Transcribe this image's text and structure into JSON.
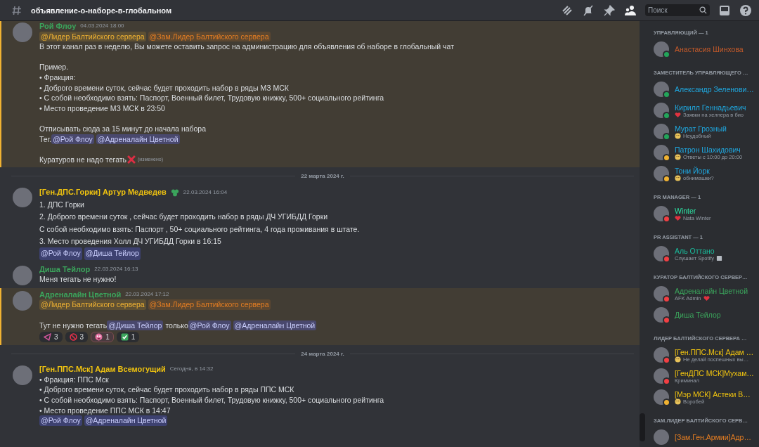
{
  "channel": {
    "name": "объявление-о-наборе-в-глобальном"
  },
  "search": {
    "placeholder": "Поиск"
  },
  "messages": [
    {
      "kind": "message",
      "author": "Рой Флоу",
      "color": "#3ba55c",
      "timestamp": "04.03.2024 18:00",
      "highlighted": true,
      "badge": false,
      "loose": false,
      "lines": [
        {
          "parts": [
            {
              "kind": "leader_mention",
              "text": "@Лидер Балтийского  сервера"
            },
            {
              "kind": "deputy_mention",
              "text": "@Зам.Лидер Балтийского сервера"
            }
          ]
        },
        {
          "parts": [
            {
              "kind": "text",
              "text": "В этот канал раз в неделю, Вы можете оставить запрос на администрацию для объявления об наборе в глобальный чат"
            }
          ]
        },
        {
          "gap": true,
          "parts": [
            {
              "kind": "text",
              "text": "Пример."
            }
          ]
        },
        {
          "parts": [
            {
              "kind": "text",
              "text": "• Фракция:"
            }
          ]
        },
        {
          "parts": [
            {
              "kind": "text",
              "text": "• Доброго времени суток, сейчас будет проходить набор в ряды МЗ МСК"
            }
          ]
        },
        {
          "parts": [
            {
              "kind": "text",
              "text": "• С собой необходимо взять: Паспорт, Военный билет, Трудовую книжку, 500+ социального рейтинга"
            }
          ]
        },
        {
          "parts": [
            {
              "kind": "text",
              "text": "• Место проведение МЗ МСК в 23:50"
            }
          ]
        },
        {
          "gap": true,
          "parts": [
            {
              "kind": "text",
              "text": "Отписывать сюда за 15 минут до начала набора"
            }
          ]
        },
        {
          "parts": [
            {
              "kind": "text",
              "text": "Тег. "
            },
            {
              "kind": "user_mention",
              "text": "@Рой Флоу"
            },
            {
              "kind": "user_mention",
              "text": "@Адреналайн Цветной"
            }
          ]
        },
        {
          "gap": true,
          "parts": [
            {
              "kind": "text",
              "text": "Куратуров не надо тегать"
            },
            {
              "kind": "cross"
            },
            {
              "kind": "edited",
              "text": "(изменено)"
            }
          ]
        }
      ]
    },
    {
      "kind": "divider",
      "text": "22 марта 2024 г."
    },
    {
      "kind": "message",
      "author": "[Ген.ДПС.Горки] Артур Медведев",
      "color": "#f1c40f",
      "timestamp": "22.03.2024 16:04",
      "highlighted": false,
      "badge": true,
      "loose": true,
      "lines": [
        {
          "parts": [
            {
              "kind": "text",
              "text": "1. ДПС Горки"
            }
          ]
        },
        {
          "parts": [
            {
              "kind": "text",
              "text": "2. Доброго времени суток , сейчас будет проходить набор в ряды ДЧ УГИБДД Горки"
            }
          ]
        },
        {
          "parts": [
            {
              "kind": "text",
              "text": "С собой необходимо взять: Паспорт , 50+ социального рейтинга, 4 года проживания в штате."
            }
          ]
        },
        {
          "parts": [
            {
              "kind": "text",
              "text": "3. Место проведения Холл ДЧ УГИБДД Горки в 16:15"
            }
          ]
        },
        {
          "parts": [
            {
              "kind": "user_mention",
              "text": "@Рой Флоу"
            },
            {
              "kind": "user_mention",
              "text": "@Диша Тейлор"
            }
          ]
        }
      ]
    },
    {
      "kind": "message",
      "author": "Диша Тейлор",
      "color": "#3ba55c",
      "timestamp": "22.03.2024 16:13",
      "highlighted": false,
      "badge": false,
      "loose": false,
      "lines": [
        {
          "parts": [
            {
              "kind": "text",
              "text": "Меня тегать не нужно!"
            }
          ]
        }
      ]
    },
    {
      "kind": "message",
      "author": "Адреналайн Цветной",
      "color": "#3ba55c",
      "timestamp": "22.03.2024 17:12",
      "highlighted": true,
      "badge": false,
      "loose": false,
      "lines": [
        {
          "parts": [
            {
              "kind": "leader_mention",
              "text": "@Лидер Балтийского  сервера"
            },
            {
              "kind": "deputy_mention",
              "text": "@Зам.Лидер Балтийского сервера"
            }
          ]
        },
        {
          "gap": true,
          "parts": [
            {
              "kind": "text",
              "text": " Тут не нужно тегать "
            },
            {
              "kind": "user_mention",
              "text": "@Диша Тейлор"
            },
            {
              "kind": "text",
              "text": " только "
            },
            {
              "kind": "user_mention",
              "text": "@Рой Флоу"
            },
            {
              "kind": "user_mention",
              "text": "@Адреналайн Цветной"
            }
          ]
        }
      ],
      "reactions": [
        {
          "kind": "triangle",
          "count": "3",
          "selected": false
        },
        {
          "kind": "forbidden",
          "count": "3",
          "selected": false
        },
        {
          "kind": "face",
          "count": "1",
          "selected": true
        },
        {
          "kind": "check",
          "count": "1",
          "selected": false
        }
      ]
    },
    {
      "kind": "divider",
      "text": "24 марта 2024 г."
    },
    {
      "kind": "message",
      "author": "[Ген.ППС.Мск] Адам Всемогущий",
      "color": "#f1c40f",
      "timestamp": "Сегодня, в 14:32",
      "highlighted": false,
      "badge": false,
      "loose": false,
      "lines": [
        {
          "parts": [
            {
              "kind": "text",
              "text": "• Фракция: ППС Мск"
            }
          ]
        },
        {
          "parts": [
            {
              "kind": "text",
              "text": "• Доброго времени суток, сейчас будет проходить набор в ряды ППС МСК"
            }
          ]
        },
        {
          "parts": [
            {
              "kind": "text",
              "text": "• С собой необходимо взять: Паспорт, Военный билет, Трудовую книжку, 500+ социального рейтинга"
            }
          ]
        },
        {
          "parts": [
            {
              "kind": "text",
              "text": "• Место проведение ППС МСК в 14:47"
            }
          ]
        },
        {
          "parts": [
            {
              "kind": "user_mention",
              "text": "@Рой Флоу"
            },
            {
              "kind": "user_mention",
              "text": "@Адреналайн Цветной"
            }
          ]
        }
      ]
    }
  ],
  "member_sections": [
    {
      "header": "УПРАВЛЯЮЩИЙ — 1",
      "members": [
        {
          "name": "Анастасия Шинхова",
          "color": "#c55a2a",
          "status": {
            "color": "#23a55a"
          }
        }
      ]
    },
    {
      "header": "ЗАМЕСТИТЕЛЬ УПРАВЛЯЮЩЕГО …",
      "members": [
        {
          "name": "Александр Зеленови…",
          "color": "#1fa8e0",
          "status": {
            "color": "#23a55a"
          }
        },
        {
          "name": "Кирилл Геннадьевич",
          "color": "#1fa8e0",
          "status": {
            "color": "#23a55a"
          },
          "activity": {
            "kind": "heart",
            "text": "Заявки на хелпера в био",
            "icon_after": false
          }
        },
        {
          "name": "Мурат Грозный",
          "color": "#1fa8e0",
          "status": {
            "color": "#23a55a"
          },
          "activity": {
            "kind": "emoji",
            "text": "Неудобный",
            "icon_after": false
          }
        },
        {
          "name": "Патрон Шахидович",
          "color": "#1fa8e0",
          "status": {
            "color": "#f0b232"
          },
          "activity": {
            "kind": "emoji",
            "text": "Ответы с 10:00 до 20:00",
            "icon_after": false
          }
        },
        {
          "name": "Тони Йорк",
          "color": "#1fa8e0",
          "status": {
            "color": "#f0b232"
          },
          "activity": {
            "kind": "emoji",
            "text": "обнимашки?",
            "icon_after": false
          }
        }
      ]
    },
    {
      "header": "PR MANAGER — 1",
      "members": [
        {
          "name": "Winter",
          "color": "#2ee6a6",
          "status": {
            "color": "#f23f43"
          },
          "activity": {
            "kind": "heart",
            "text": "Nata Winter",
            "icon_after": false
          }
        }
      ]
    },
    {
      "header": "PR ASSISTANT — 1",
      "members": [
        {
          "name": "Аль Оттано",
          "color": "#1abc9c",
          "status": {
            "color": "#f23f43"
          },
          "activity": {
            "kind": "square",
            "text": "Слушает Spotify",
            "icon_after": true
          }
        }
      ]
    },
    {
      "header": "КУРАТОР БАЛТИЙСКОГО СЕРВЕР…",
      "members": [
        {
          "name": "Адреналайн Цветной",
          "color": "#3ba55c",
          "status": {
            "color": "#f23f43"
          },
          "activity": {
            "kind": "heart",
            "text": "AFK Admin",
            "icon_after": true
          }
        },
        {
          "name": "Диша Тейлор",
          "color": "#3ba55c",
          "status": {
            "color": "#f23f43"
          }
        }
      ]
    },
    {
      "header": "ЛИДЕР БАЛТИЙСКОГО СЕРВЕРА …",
      "members": [
        {
          "name": "[Ген.ППС.Мск] Адам …",
          "color": "#f1c40f",
          "status": {
            "color": "#f23f43"
          },
          "activity": {
            "kind": "emoji",
            "text": "Не делай поспешных вы…",
            "icon_after": false
          }
        },
        {
          "name": "[ГенДПС МСК]Мухам…",
          "color": "#f1c40f",
          "status": {
            "color": "#f23f43"
          },
          "activity": {
            "kind": "plain",
            "text": "Криминал",
            "icon_after": false
          }
        },
        {
          "name": "[Мэр МСК] Астеки В…",
          "color": "#f1c40f",
          "status": {
            "color": "#f0b232"
          },
          "activity": {
            "kind": "emoji",
            "text": "Воробей",
            "icon_after": false
          }
        }
      ]
    },
    {
      "header": "ЗАМ.ЛИДЕР БАЛТИЙСКОГО СЕРВ…",
      "members": [
        {
          "name": "[Зам.Ген.Армии]Адр…",
          "color": "#e67e22"
        }
      ]
    }
  ]
}
